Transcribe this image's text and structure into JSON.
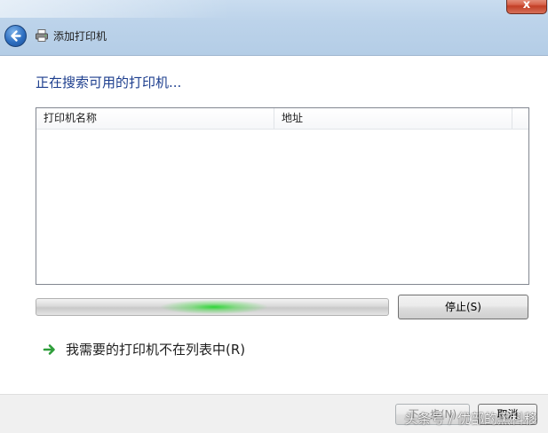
{
  "window": {
    "title": "添加打印机",
    "close_label": "x"
  },
  "main": {
    "heading": "正在搜索可用的打印机...",
    "list": {
      "columns": [
        "打印机名称",
        "地址"
      ],
      "rows": []
    },
    "progress": {
      "state": "indeterminate"
    },
    "stop_label": "停止(S)",
    "not_listed_link": "我需要的打印机不在列表中(R)"
  },
  "footer": {
    "next_label": "下一步(N)",
    "cancel_label": "取消"
  },
  "watermark": "头条号 / 优部的黑科移",
  "colors": {
    "heading": "#1d3e8e",
    "progress_glow": "#26d630",
    "link_arrow": "#2e9e3a"
  },
  "icons": {
    "back": "back-arrow-icon",
    "printer": "printer-icon",
    "link_arrow": "green-arrow-right-icon"
  }
}
